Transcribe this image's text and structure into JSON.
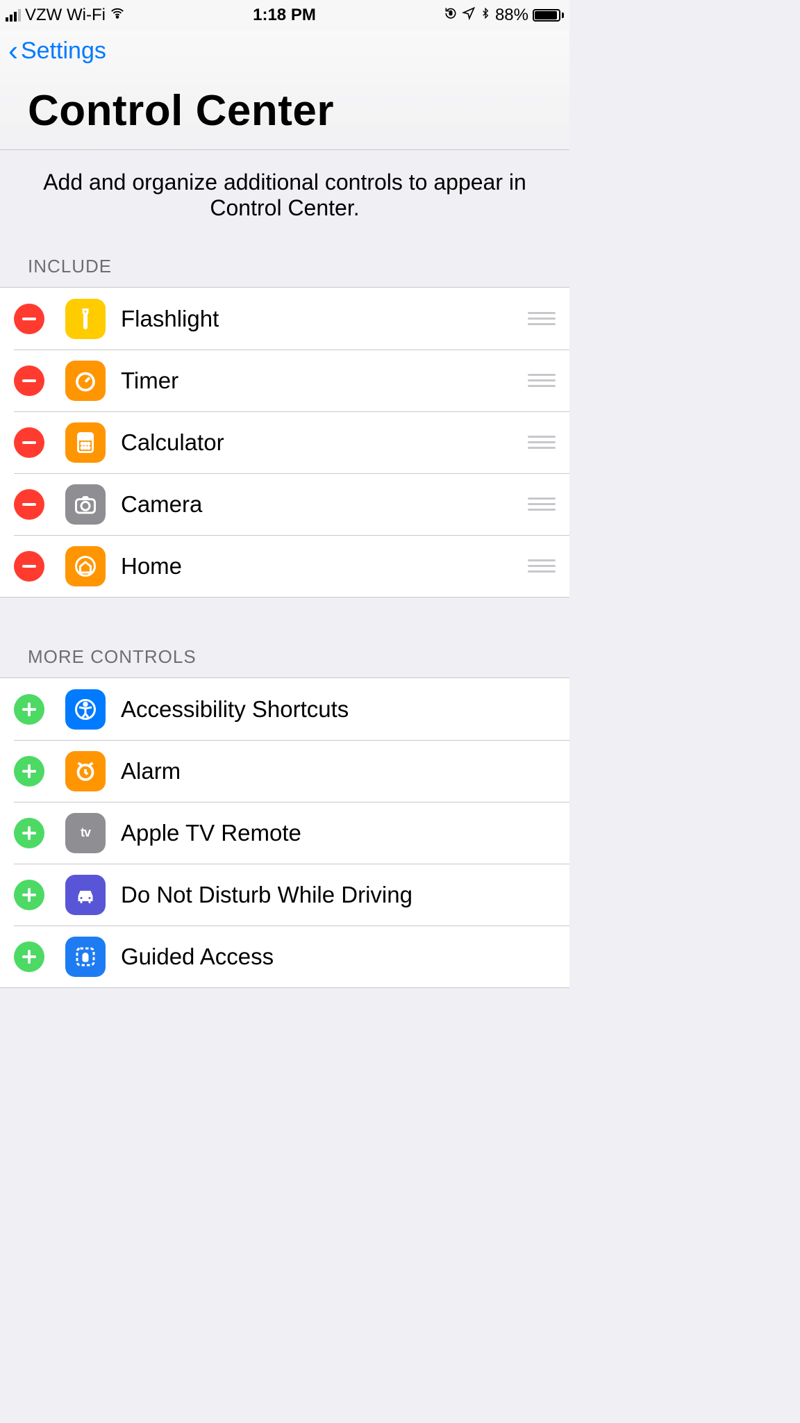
{
  "status_bar": {
    "carrier": "VZW Wi-Fi",
    "time": "1:18 PM",
    "battery_pct": "88%"
  },
  "nav": {
    "back_label": "Settings",
    "title": "Control Center"
  },
  "description": "Add and organize additional controls to appear in Control Center.",
  "sections": {
    "include": {
      "header": "INCLUDE",
      "items": [
        {
          "label": "Flashlight",
          "icon": "flashlight",
          "bg": "bg-yellow"
        },
        {
          "label": "Timer",
          "icon": "timer",
          "bg": "bg-orange"
        },
        {
          "label": "Calculator",
          "icon": "calculator",
          "bg": "bg-orange"
        },
        {
          "label": "Camera",
          "icon": "camera",
          "bg": "bg-gray"
        },
        {
          "label": "Home",
          "icon": "home",
          "bg": "bg-orange"
        }
      ]
    },
    "more": {
      "header": "MORE CONTROLS",
      "items": [
        {
          "label": "Accessibility Shortcuts",
          "icon": "accessibility",
          "bg": "bg-blue"
        },
        {
          "label": "Alarm",
          "icon": "alarm",
          "bg": "bg-orange"
        },
        {
          "label": "Apple TV Remote",
          "icon": "appletv",
          "bg": "bg-gray"
        },
        {
          "label": "Do Not Disturb While Driving",
          "icon": "car",
          "bg": "bg-indigo"
        },
        {
          "label": "Guided Access",
          "icon": "lock",
          "bg": "bg-blue2"
        }
      ]
    }
  }
}
